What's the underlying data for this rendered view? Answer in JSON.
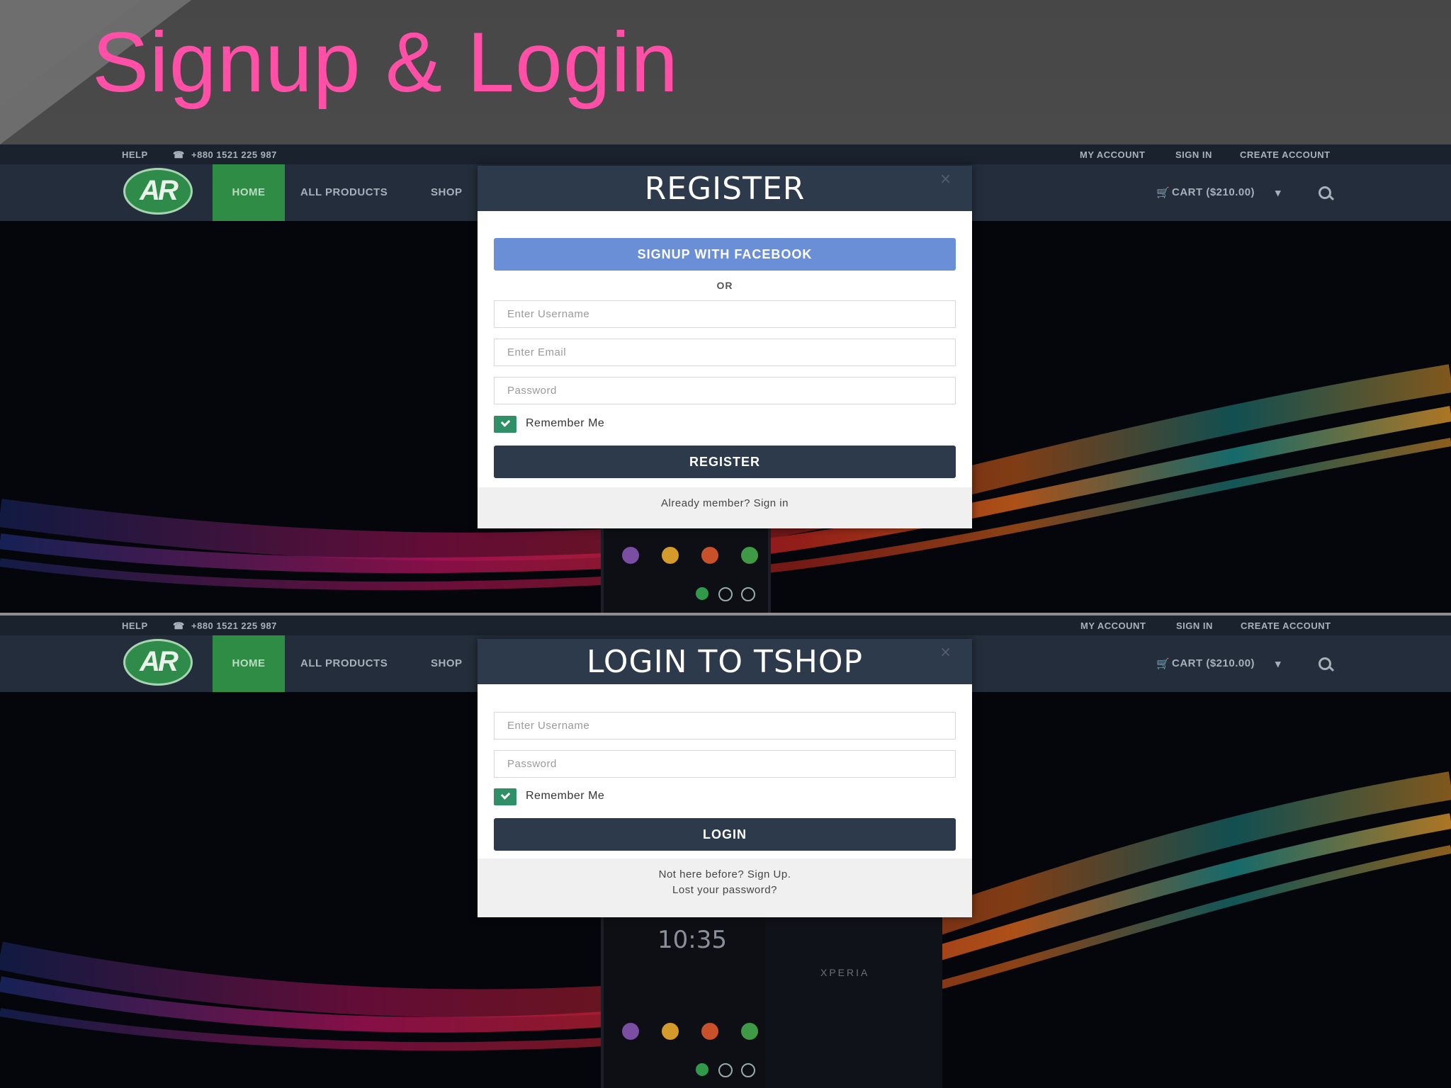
{
  "slide": {
    "title": "Signup & Login"
  },
  "site": {
    "topbar": {
      "help": "HELP",
      "phone": "+880 1521 225 987",
      "my_account": "MY ACCOUNT",
      "sign_in": "SIGN IN",
      "create_account": "CREATE ACCOUNT"
    },
    "nav": {
      "logo": "AR",
      "home": "HOME",
      "all_products": "ALL PRODUCTS",
      "shop": "SHOP",
      "cart": "CART ($210.00)",
      "search_icon": "search-icon",
      "cart_icon": "cart-icon",
      "phone_icon": "phone-icon"
    },
    "colors": {
      "accent_pink": "#ff4fa7",
      "nav_dark": "#232d3b",
      "home_green": "#2f8c45",
      "facebook_blue": "#6b8fd6",
      "modal_header": "#2d3a4c",
      "checkbox_green": "#2f8f67"
    }
  },
  "register_modal": {
    "title": "REGISTER",
    "close": "×",
    "facebook_button": "SIGNUP WITH FACEBOOK",
    "or": "OR",
    "username_placeholder": "Enter Username",
    "email_placeholder": "Enter Email",
    "password_placeholder": "Password",
    "remember_me": "Remember Me",
    "remember_checked": true,
    "submit": "REGISTER",
    "footer_link": "Already member? Sign in"
  },
  "login_modal": {
    "title": "LOGIN TO TSHOP",
    "close": "×",
    "username_placeholder": "Enter Username",
    "password_placeholder": "Password",
    "remember_me": "Remember Me",
    "remember_checked": true,
    "submit": "LOGIN",
    "footer_signup": "Not here before? Sign Up.",
    "footer_lost_password": "Lost your password?"
  },
  "background": {
    "phone_clock": "10:35",
    "phone_brand": "XPERIA"
  }
}
